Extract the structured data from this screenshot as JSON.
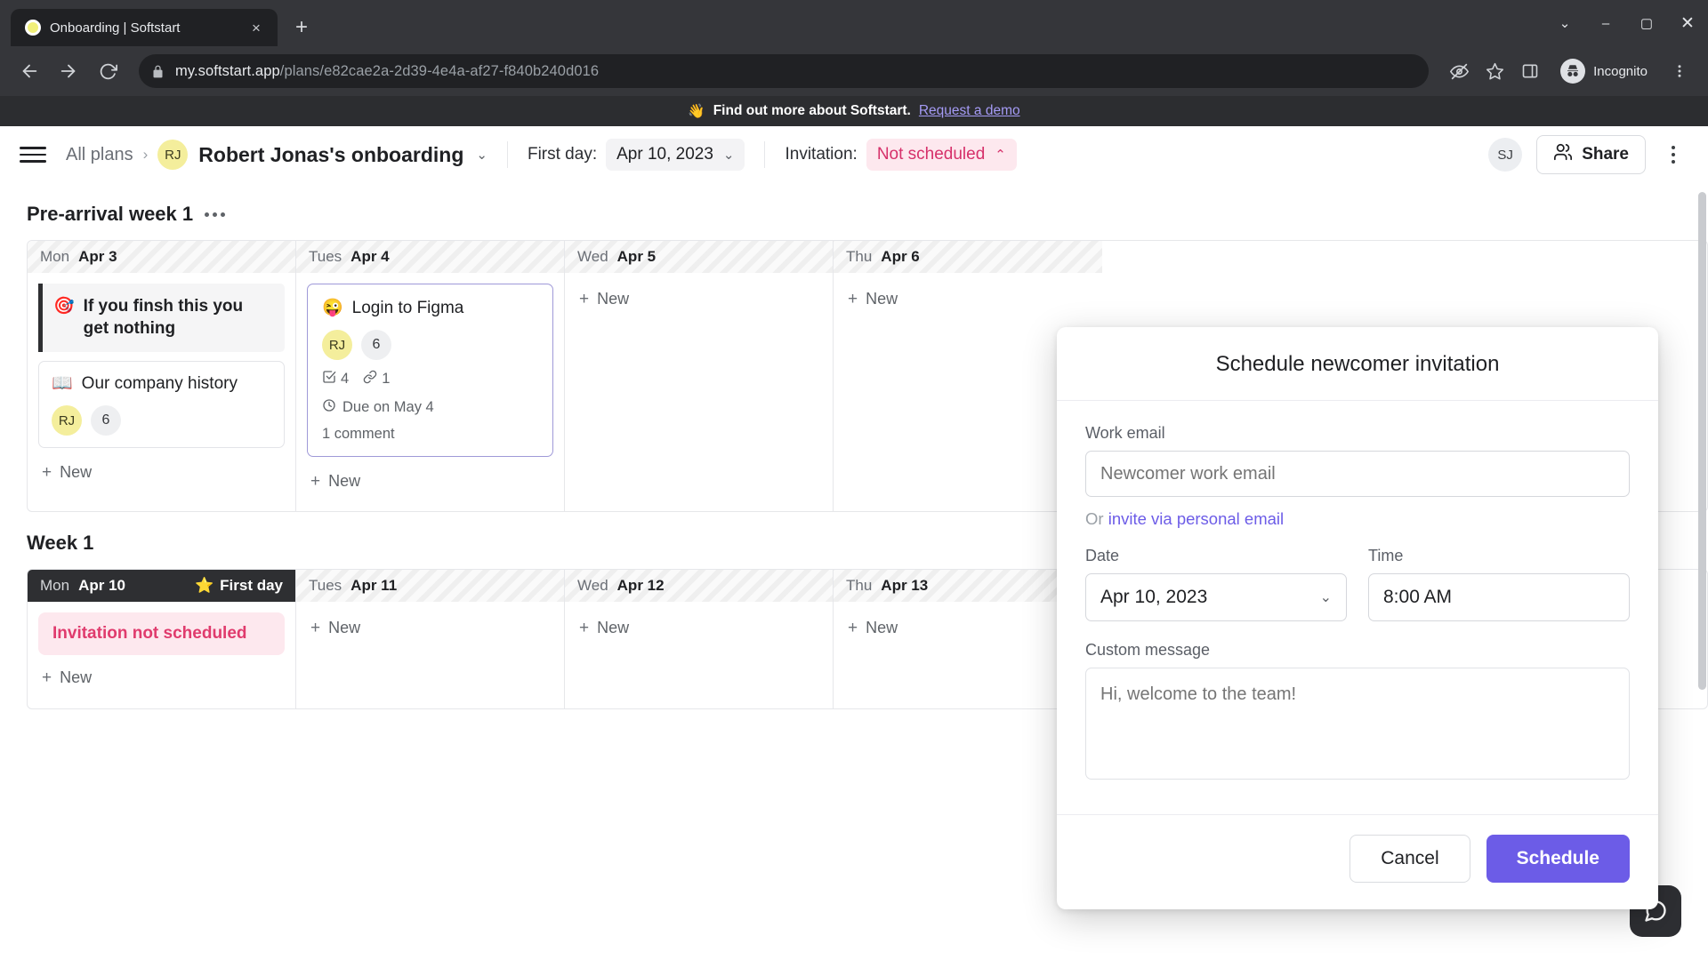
{
  "browser": {
    "tab": {
      "title": "Onboarding | Softstart",
      "favicon": "softstart-logo-icon",
      "close": "×"
    },
    "new_tab_label": "+",
    "window_controls": {
      "minimize_all": "⌄",
      "minimize": "–",
      "maximize": "▢",
      "close": "✕"
    },
    "nav": {
      "back": "back-arrow-icon",
      "forward": "forward-arrow-icon",
      "reload": "reload-icon"
    },
    "url_host": "my.softstart.app",
    "url_path": "/plans/e82cae2a-2d39-4e4a-af27-f840b240d016",
    "toolbar_icons": [
      "no-tracking-icon",
      "bookmark-star-icon",
      "side-panel-icon"
    ],
    "incognito_label": "Incognito",
    "menu": "kebab-menu-icon"
  },
  "promo": {
    "emoji": "👋",
    "text": "Find out more about Softstart.",
    "link": "Request a demo"
  },
  "appbar": {
    "menu_icon": "hamburger-icon",
    "breadcrumb_root": "All plans",
    "breadcrumb_sep": "›",
    "avatar_initials": "RJ",
    "plan_title": "Robert Jonas's onboarding",
    "plan_caret": "⌄",
    "first_day_label": "First day:",
    "first_day_value": "Apr 10, 2023",
    "first_day_caret": "⌄",
    "invitation_label": "Invitation:",
    "invitation_value": "Not scheduled",
    "invitation_caret": "⌃",
    "user_initials": "SJ",
    "share_label": "Share",
    "share_icon": "people-icon",
    "more_icon": "kebab-menu-icon"
  },
  "board": {
    "sections": [
      {
        "title": "Pre-arrival week 1",
        "menu": "ellipsis-icon",
        "days": [
          {
            "weekday": "Mon",
            "date": "Apr 3",
            "first_day": false,
            "cards": [
              {
                "style": "accent",
                "emoji": "🎯",
                "title": "If you finsh this you get nothing",
                "meta": [],
                "stats": [],
                "due": null,
                "comments": null
              },
              {
                "style": "plain",
                "emoji": "📖",
                "title": "Our company history",
                "meta": [
                  {
                    "kind": "avatar",
                    "text": "RJ"
                  },
                  {
                    "kind": "count",
                    "text": "6"
                  }
                ],
                "stats": [],
                "due": null,
                "comments": null
              }
            ],
            "new_label": "New"
          },
          {
            "weekday": "Tues",
            "date": "Apr 4",
            "first_day": false,
            "cards": [
              {
                "style": "active",
                "emoji": "😜",
                "title": "Login to Figma",
                "meta": [
                  {
                    "kind": "avatar",
                    "text": "RJ"
                  },
                  {
                    "kind": "count",
                    "text": "6"
                  }
                ],
                "stats": [
                  {
                    "icon": "checklist-icon",
                    "text": "4"
                  },
                  {
                    "icon": "link-icon",
                    "text": "1"
                  }
                ],
                "due": {
                  "icon": "clock-icon",
                  "text": "Due on May 4"
                },
                "comments": "1 comment"
              }
            ],
            "new_label": "New"
          },
          {
            "weekday": "Wed",
            "date": "Apr 5",
            "first_day": false,
            "cards": [],
            "new_label": "New"
          },
          {
            "weekday": "Thu",
            "date": "Apr 6",
            "first_day": false,
            "cards": [],
            "new_label": "New"
          }
        ]
      },
      {
        "title": "Week 1",
        "menu": null,
        "days": [
          {
            "weekday": "Mon",
            "date": "Apr 10",
            "first_day": true,
            "first_day_badge": "First day",
            "first_day_emoji": "⭐",
            "cards": [],
            "invite_pill": "Invitation not scheduled",
            "new_label": "New"
          },
          {
            "weekday": "Tues",
            "date": "Apr 11",
            "first_day": false,
            "cards": [],
            "new_label": "New"
          },
          {
            "weekday": "Wed",
            "date": "Apr 12",
            "first_day": false,
            "cards": [],
            "new_label": "New"
          },
          {
            "weekday": "Thu",
            "date": "Apr 13",
            "first_day": false,
            "cards": [],
            "new_label": "New"
          }
        ]
      }
    ]
  },
  "modal": {
    "title": "Schedule newcomer invitation",
    "work_email_label": "Work email",
    "work_email_value": "",
    "work_email_placeholder": "Newcomer work email",
    "or_text": "Or",
    "personal_email_link": "invite via personal email",
    "date_label": "Date",
    "date_value": "Apr 10, 2023",
    "date_caret": "⌄",
    "time_label": "Time",
    "time_value": "8:00 AM",
    "custom_message_label": "Custom message",
    "custom_message_value": "",
    "custom_message_placeholder": "Hi, welcome to the team!",
    "cancel_label": "Cancel",
    "schedule_label": "Schedule"
  },
  "chat_widget": {
    "icon": "chat-bubble-icon"
  },
  "colors": {
    "accent_purple": "#6c5ce7",
    "warn_pink_bg": "#fde8ee",
    "warn_pink_fg": "#e03b6d",
    "avatar_yellow": "#f4ee9c",
    "dark": "#2e2f32"
  }
}
